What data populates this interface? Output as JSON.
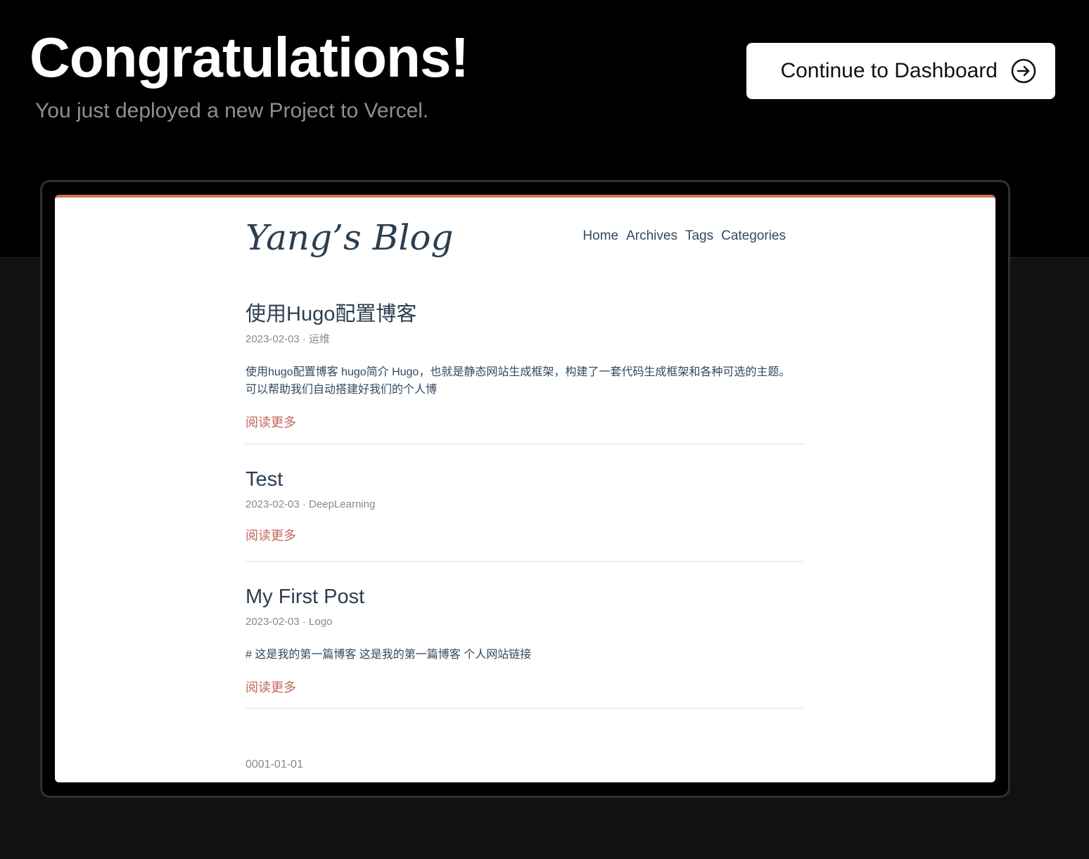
{
  "header": {
    "title": "Congratulations!",
    "subtitle": "You just deployed a new Project to Vercel.",
    "cta_label": "Continue to Dashboard",
    "cta_icon": "arrow-right-circle-icon"
  },
  "preview": {
    "accent_color": "#d0705a",
    "blog_title": "Yang’s Blog",
    "nav": [
      "Home",
      "Archives",
      "Tags",
      "Categories"
    ],
    "posts": [
      {
        "title": "使用Hugo配置博客",
        "meta": "2023-02-03 · 运维",
        "excerpt": "使用hugo配置博客 hugo简介 Hugo，也就是静态网站生成框架，构建了一套代码生成框架和各种可选的主题。可以帮助我们自动搭建好我们的个人博",
        "read_more": "阅读更多"
      },
      {
        "title": "Test",
        "meta": "2023-02-03 · DeepLearning",
        "excerpt": "",
        "read_more": "阅读更多"
      },
      {
        "title": "My First Post",
        "meta": "2023-02-03 · Logo",
        "excerpt": "# 这是我的第一篇博客 这是我的第一篇博客 个人网站链接",
        "read_more": "阅读更多"
      }
    ],
    "footer_date": "0001-01-01"
  }
}
